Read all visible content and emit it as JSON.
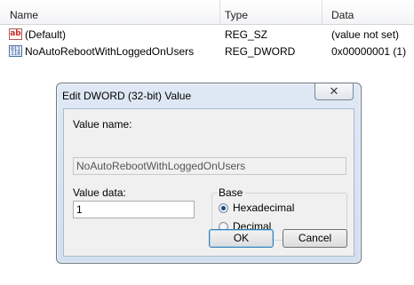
{
  "list": {
    "columns": {
      "name": "Name",
      "type": "Type",
      "data": "Data"
    },
    "rows": [
      {
        "icon": "string-value-icon",
        "icon_glyph": "ab",
        "name": "(Default)",
        "type": "REG_SZ",
        "data": "(value not set)"
      },
      {
        "icon": "dword-value-icon",
        "icon_glyph": "011 110",
        "name": "NoAutoRebootWithLoggedOnUsers",
        "type": "REG_DWORD",
        "data": "0x00000001 (1)"
      }
    ]
  },
  "dialog": {
    "title": "Edit DWORD (32-bit) Value",
    "close_glyph": "✕",
    "value_name_label": "Value name:",
    "value_name": "NoAutoRebootWithLoggedOnUsers",
    "value_data_label": "Value data:",
    "value_data": "1",
    "base_label": "Base",
    "base_options": [
      {
        "label": "Hexadecimal",
        "checked": true
      },
      {
        "label": "Decimal",
        "checked": false
      }
    ],
    "ok_label": "OK",
    "cancel_label": "Cancel"
  }
}
